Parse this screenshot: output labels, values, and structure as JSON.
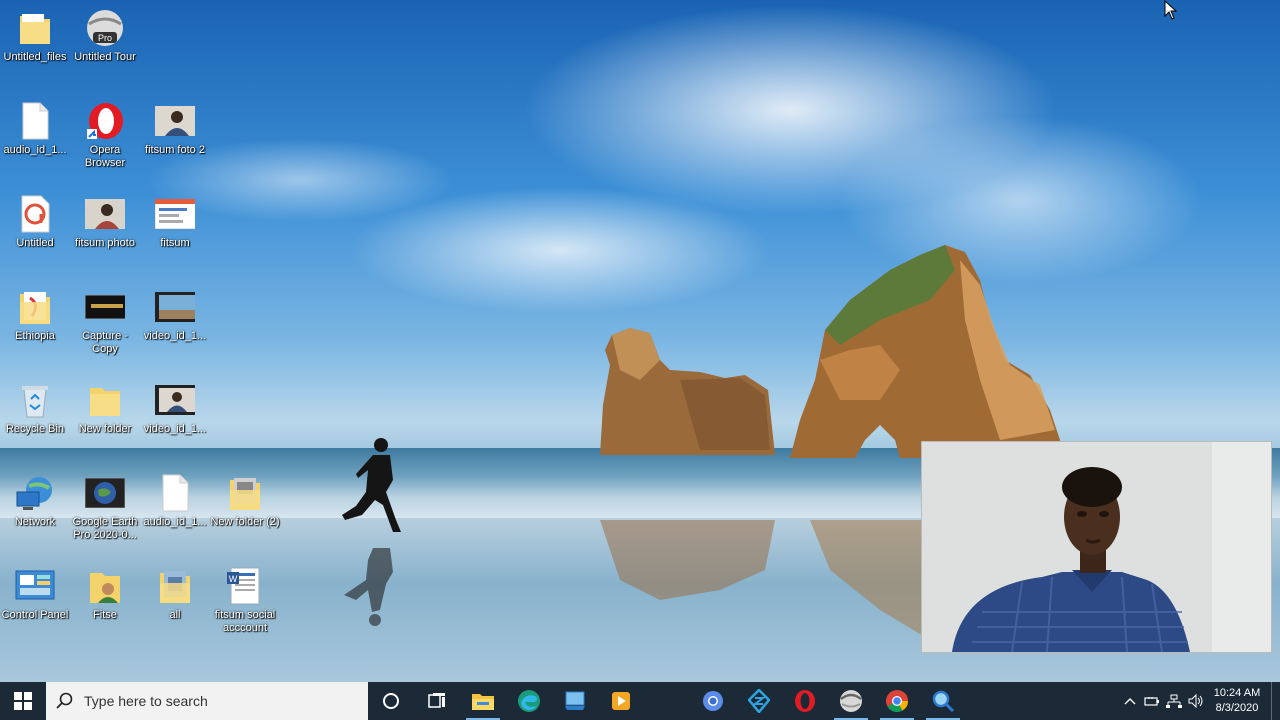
{
  "desktop": {
    "icons": [
      {
        "label": "Untitled_files",
        "icon": "folder-icon"
      },
      {
        "label": "Untitled Tour",
        "icon": "google-earth-pro-icon"
      },
      {
        "label": "audio_id_1...",
        "icon": "file-icon"
      },
      {
        "label": "Opera Browser",
        "icon": "opera-icon"
      },
      {
        "label": "fitsum foto 2",
        "icon": "photo-thumbnail-icon"
      },
      {
        "label": "Untitled",
        "icon": "app-file-icon"
      },
      {
        "label": "fitsum photo",
        "icon": "photo-thumbnail-icon"
      },
      {
        "label": "fitsum",
        "icon": "screenshot-thumbnail-icon"
      },
      {
        "label": "Ethiopia",
        "icon": "folder-icon"
      },
      {
        "label": "Capture - Copy",
        "icon": "image-thumbnail-icon"
      },
      {
        "label": "video_id_1...",
        "icon": "video-thumbnail-icon"
      },
      {
        "label": "Recycle Bin",
        "icon": "recycle-bin-icon"
      },
      {
        "label": "New folder",
        "icon": "folder-icon"
      },
      {
        "label": "video_id_1...",
        "icon": "video-thumbnail-icon"
      },
      {
        "label": "Network",
        "icon": "network-icon"
      },
      {
        "label": "Google Earth Pro 2020-0...",
        "icon": "google-earth-image-icon"
      },
      {
        "label": "audio_id_1...",
        "icon": "file-icon"
      },
      {
        "label": "New folder (2)",
        "icon": "folder-icon"
      },
      {
        "label": "Control Panel",
        "icon": "control-panel-icon"
      },
      {
        "label": "Fitse",
        "icon": "user-folder-icon"
      },
      {
        "label": "all",
        "icon": "folder-icon"
      },
      {
        "label": "fitsum social acccount",
        "icon": "document-icon"
      }
    ]
  },
  "taskbar": {
    "search_placeholder": "Type here to search",
    "apps": [
      "cortana-icon",
      "task-view-icon",
      "file-explorer-icon",
      "edge-icon",
      "remote-desktop-icon",
      "media-player-icon",
      "chromium-icon",
      "sourcetree-icon",
      "opera-icon",
      "google-earth-icon",
      "chrome-icon",
      "magnifier-icon"
    ],
    "clock_time": "10:24 AM",
    "clock_date": "8/3/2020"
  },
  "colors": {
    "taskbar": "#1c2a38",
    "search_box": "#f2f2f2",
    "running_indicator": "#79b8e8"
  }
}
